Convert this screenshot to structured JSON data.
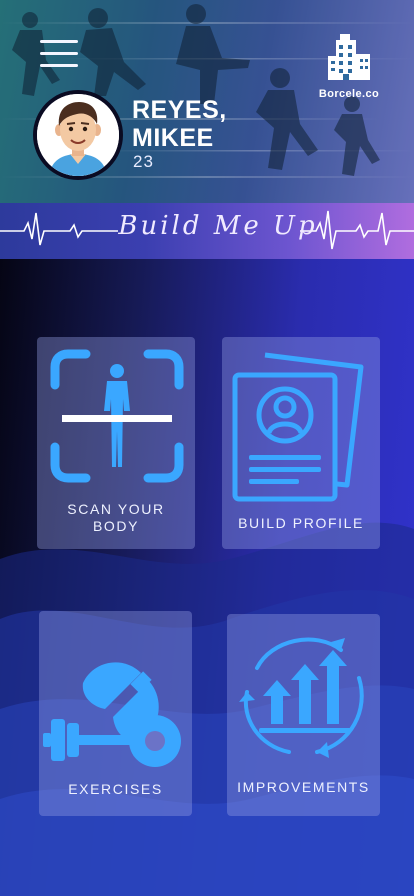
{
  "app": {
    "brand_name": "Borcele.co",
    "tagline": "Build Me Up"
  },
  "user": {
    "name_line1": "REYES,",
    "name_line2": "MIKEE",
    "age": "23"
  },
  "tiles": [
    {
      "id": "scan",
      "label_line1": "SCAN YOUR",
      "label_line2": "BODY",
      "icon": "body-scan-icon"
    },
    {
      "id": "profile",
      "label_line1": "BUILD PROFILE",
      "label_line2": "",
      "icon": "profile-document-icon"
    },
    {
      "id": "exercises",
      "label_line1": "EXERCISES",
      "label_line2": "",
      "icon": "dumbbell-icon"
    },
    {
      "id": "improvements",
      "label_line1": "IMPROVEMENTS",
      "label_line2": "",
      "icon": "progress-chart-icon"
    }
  ],
  "colors": {
    "icon_blue": "#3aa7ff",
    "tile_bg": "rgba(150,160,230,0.38)",
    "banner_start": "#2d3a9c",
    "banner_end": "#b06ddf"
  }
}
